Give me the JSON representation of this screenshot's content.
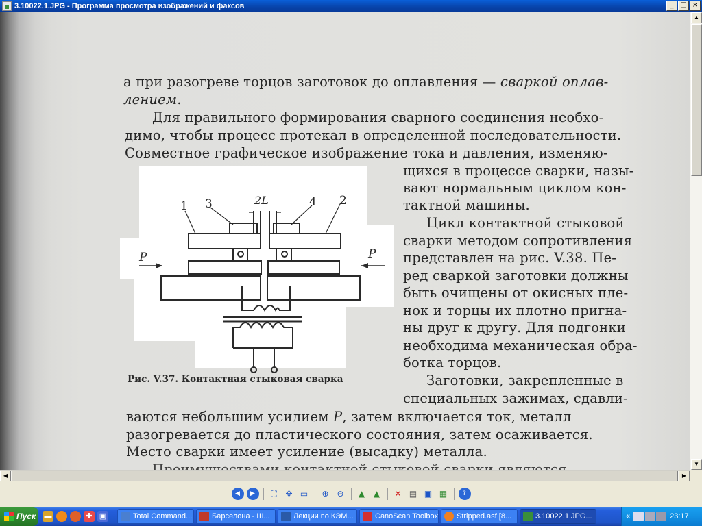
{
  "window": {
    "title": "3.10022.1.JPG - Программа просмотра изображений и факсов",
    "buttons": {
      "minimize": "_",
      "maximize": "□",
      "close": "×"
    }
  },
  "document": {
    "lines": {
      "l1a": "а при разогреве торцов заготовок до оплавления — ",
      "l1b": "сваркой оплав-",
      "l2": "лением",
      "l2end": ".",
      "l3": "Для правильного формирования сварного соединения необхо-",
      "l4": "димо, чтобы процесс протекал в определенной последовательности.",
      "l5": "Совместное графическое изображение тока и давления, изменяю-",
      "r1": "щихся в процессе сварки, назы-",
      "r2": "вают нормальным циклом кон-",
      "r3": "тактной машины.",
      "r4": "Цикл контактной стыковой",
      "r5": "сварки методом сопротивления",
      "r6": "представлен на рис. V.38. Пе-",
      "r7": "ред сваркой заготовки должны",
      "r8": "быть очищены от окисных пле-",
      "r9": "нок и торцы их плотно пригна-",
      "r10": "ны друг к другу. Для подгонки",
      "r11": "необходима механическая обра-",
      "r12": "ботка торцов.",
      "r13": "Заготовки, закрепленные в",
      "r14": "специальных зажимах, сдавли-",
      "b1": "ваются небольшим усилием ",
      "b1p": "P",
      "b1end": ", затем включается ток, металл",
      "b2": "разогревается до пластического состояния, затем осаживается.",
      "b3": "Место сварки имеет усиление (высадку) металла.",
      "b4": "Преимуществами контактной стыковой сварки являются"
    },
    "caption": "Рис. V.37. Контактная стыковая сварка",
    "figure_labels": {
      "n1": "1",
      "n2": "2",
      "n3": "3",
      "n4": "4",
      "gap": "2L",
      "p_left": "P",
      "p_right": "P"
    }
  },
  "toolbar": {
    "icons": [
      "prev-image-icon",
      "next-image-icon",
      "best-fit-icon",
      "actual-size-icon",
      "slideshow-icon",
      "zoom-in-icon",
      "zoom-out-icon",
      "rotate-clockwise-icon",
      "rotate-counterclockwise-icon",
      "delete-icon",
      "print-icon",
      "save-icon",
      "open-editor-icon",
      "help-icon"
    ]
  },
  "taskbar": {
    "start": "Пуск",
    "tasks": [
      {
        "label": "Total Command...",
        "color": "#4a7fd0"
      },
      {
        "label": "Барселона - Ш...",
        "color": "#c0392b"
      },
      {
        "label": "Лекции по КЭМ...",
        "color": "#2a5aa8"
      },
      {
        "label": "CanoScan Toolbox",
        "color": "#d23030"
      },
      {
        "label": "Stripped.asf  [8...",
        "color": "#f08020"
      },
      {
        "label": "3.10022.1.JPG...",
        "color": "#3a8f3a"
      }
    ],
    "tray_expand": "«",
    "clock": "23:17"
  }
}
